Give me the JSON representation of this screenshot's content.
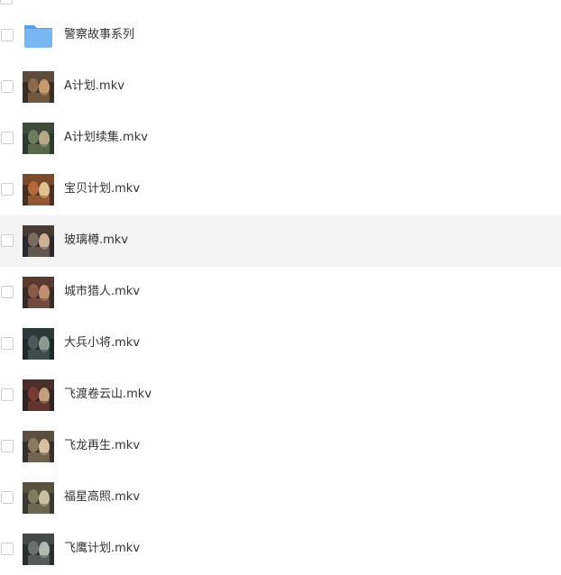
{
  "colors": {
    "folder": "#7ab7f2",
    "folder_dark": "#5aa2e8",
    "row_hover": "#f4f4f4",
    "text": "#333333",
    "checkbox_border": "#cfcfcf"
  },
  "files": [
    {
      "name": "警察故事系列",
      "kind": "folder",
      "icon": "folder-icon"
    },
    {
      "name": "A计划.mkv",
      "kind": "video",
      "icon": "video-thumbnail"
    },
    {
      "name": "A计划续集.mkv",
      "kind": "video",
      "icon": "video-thumbnail"
    },
    {
      "name": "宝贝计划.mkv",
      "kind": "video",
      "icon": "video-thumbnail"
    },
    {
      "name": "玻璃樽.mkv",
      "kind": "video",
      "icon": "video-thumbnail",
      "hovered": true
    },
    {
      "name": "城市猎人.mkv",
      "kind": "video",
      "icon": "video-thumbnail"
    },
    {
      "name": "大兵小将.mkv",
      "kind": "video",
      "icon": "video-thumbnail"
    },
    {
      "name": "飞渡卷云山.mkv",
      "kind": "video",
      "icon": "video-thumbnail"
    },
    {
      "name": "飞龙再生.mkv",
      "kind": "video",
      "icon": "video-thumbnail"
    },
    {
      "name": "福星高照.mkv",
      "kind": "video",
      "icon": "video-thumbnail"
    },
    {
      "name": "飞鹰计划.mkv",
      "kind": "video",
      "icon": "video-thumbnail"
    }
  ]
}
